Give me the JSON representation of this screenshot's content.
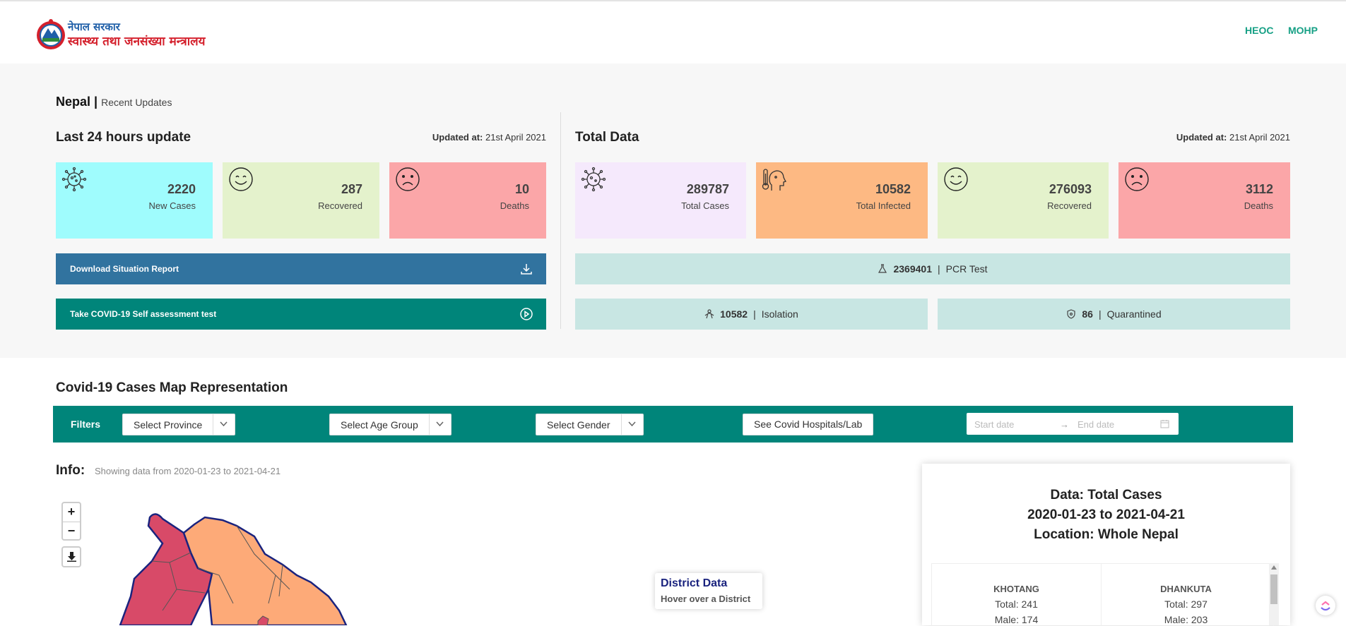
{
  "header": {
    "logo_line1": "नेपाल सरकार",
    "logo_line2": "स्वास्थ्य तथा जनसंख्या मन्त्रालय",
    "nav": [
      "HEOC",
      "MOHP"
    ]
  },
  "breadcrumb": {
    "country": "Nepal |",
    "sub": "Recent Updates"
  },
  "last24": {
    "title": "Last 24 hours update",
    "updated_label": "Updated at:",
    "updated_value": "21st April 2021",
    "cards": [
      {
        "value": "2220",
        "label": "New Cases",
        "icon": "virus-icon",
        "color": "#9ffcfd"
      },
      {
        "value": "287",
        "label": "Recovered",
        "icon": "smile-icon",
        "color": "#e4f2cc"
      },
      {
        "value": "10",
        "label": "Deaths",
        "icon": "sad-icon",
        "color": "#fba6a8"
      }
    ],
    "download_label": "Download Situation Report",
    "selftest_label": "Take COVID-19 Self assessment test"
  },
  "total": {
    "title": "Total Data",
    "updated_label": "Updated at:",
    "updated_value": "21st April 2021",
    "cards": [
      {
        "value": "289787",
        "label": "Total Cases",
        "icon": "virus-icon",
        "color": "#f5e9fc"
      },
      {
        "value": "10582",
        "label": "Total Infected",
        "icon": "fever-icon",
        "color": "#fdb983"
      },
      {
        "value": "276093",
        "label": "Recovered",
        "icon": "smile-icon",
        "color": "#e4f2cc"
      },
      {
        "value": "3112",
        "label": "Deaths",
        "icon": "sad-icon",
        "color": "#fba6a8"
      }
    ],
    "pcr": {
      "value": "2369401",
      "sep": "|",
      "label": "PCR Test"
    },
    "isolation": {
      "value": "10582",
      "sep": "|",
      "label": "Isolation"
    },
    "quarantined": {
      "value": "86",
      "sep": "|",
      "label": "Quarantined"
    }
  },
  "map": {
    "title": "Covid-19 Cases Map Representation",
    "filters_label": "Filters",
    "province": "Select Province",
    "age": "Select Age Group",
    "gender": "Select Gender",
    "hospitals": "See Covid Hospitals/Lab",
    "start_date": "Start date",
    "end_date": "End date",
    "arrow": "→",
    "info_title": "Info:",
    "info_sub": "Showing data from 2020-01-23 to 2021-04-21",
    "zoom_in": "+",
    "zoom_out": "−",
    "district_title": "District Data",
    "district_hint": "Hover over a District"
  },
  "panel": {
    "line1": "Data: Total Cases",
    "line2": "2020-01-23 to 2021-04-21",
    "line3": "Location: Whole Nepal",
    "districts": [
      {
        "name": "KHOTANG",
        "total": "Total: 241",
        "male": "Male: 174"
      },
      {
        "name": "DHANKUTA",
        "total": "Total: 297",
        "male": "Male: 203"
      }
    ]
  },
  "colors": {
    "teal": "#00857a",
    "blue": "#31739f",
    "light_teal": "#c8e6e3",
    "map_red": "#d84a68",
    "map_orange": "#fdaa78"
  }
}
